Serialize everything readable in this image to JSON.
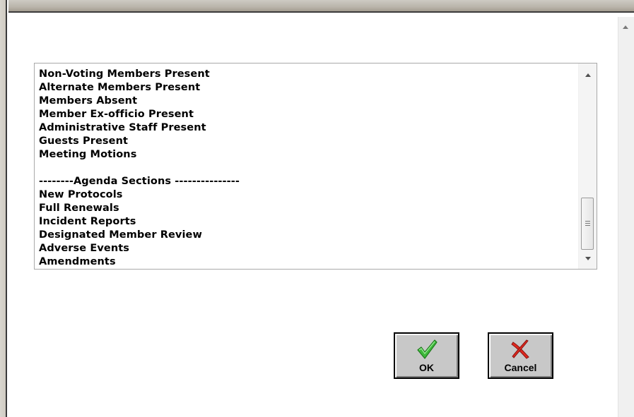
{
  "list": {
    "items": [
      "Non-Voting Members Present",
      "Alternate Members Present",
      "Members Absent",
      "Member Ex-officio Present",
      "Administrative Staff Present",
      "Guests Present",
      "Meeting Motions",
      "",
      "--------Agenda Sections ---------------",
      "New Protocols",
      "Full Renewals",
      "Incident Reports",
      "Designated Member Review",
      "Adverse Events",
      "Amendments"
    ]
  },
  "buttons": {
    "ok_label": "OK",
    "cancel_label": "Cancel",
    "ok_icon": "green-checkmark-icon",
    "cancel_icon": "red-x-icon"
  },
  "colors": {
    "ok_icon": "#3db83a",
    "cancel_icon": "#e0281e",
    "button_face": "#c8c8c8"
  }
}
